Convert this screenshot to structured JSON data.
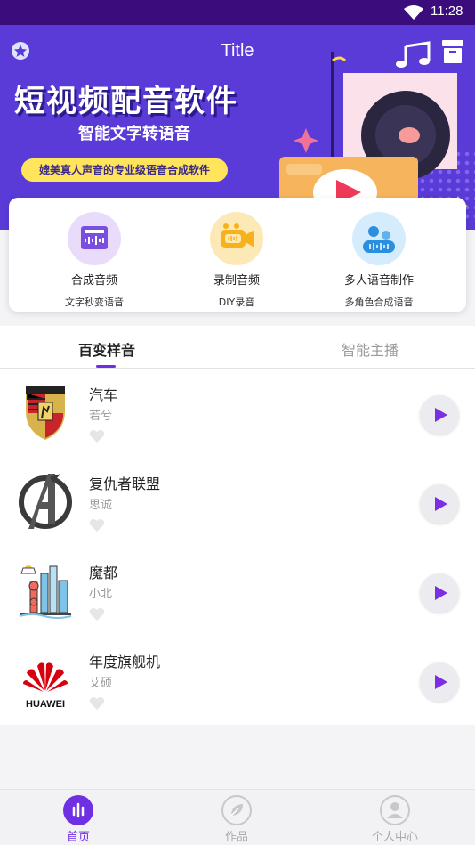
{
  "status_bar": {
    "time": "11:28"
  },
  "header": {
    "title": "Title"
  },
  "banner": {
    "headline": "短视频配音软件",
    "subtitle": "智能文字转语音",
    "tagline": "媲美真人声音的专业级语音合成软件"
  },
  "features": [
    {
      "title": "合成音频",
      "desc": "文字秒变语音",
      "icon": "audio-synth-icon",
      "color": "#e9dcfa"
    },
    {
      "title": "录制音频",
      "desc": "DIY录音",
      "icon": "record-video-icon",
      "color": "#fde9b5"
    },
    {
      "title": "多人语音制作",
      "desc": "多角色合成语音",
      "icon": "multi-voice-icon",
      "color": "#d4ecfb"
    }
  ],
  "tabs": [
    {
      "label": "百变样音",
      "active": true
    },
    {
      "label": "智能主播",
      "active": false
    }
  ],
  "list": [
    {
      "name": "汽车",
      "voice": "若兮",
      "logo": "porsche-logo"
    },
    {
      "name": "复仇者联盟",
      "voice": "思诚",
      "logo": "avengers-logo"
    },
    {
      "name": "魔都",
      "voice": "小北",
      "logo": "shanghai-skyline-logo"
    },
    {
      "name": "年度旗舰机",
      "voice": "艾硕",
      "logo": "huawei-logo",
      "logo_text": "HUAWEI"
    }
  ],
  "bottom_nav": [
    {
      "label": "首页",
      "active": true,
      "icon": "home-bars-icon"
    },
    {
      "label": "作品",
      "active": false,
      "icon": "leaf-icon"
    },
    {
      "label": "个人中心",
      "active": false,
      "icon": "person-icon"
    }
  ],
  "colors": {
    "accent": "#6f2fe3",
    "banner": "#5a3bd7",
    "status_bar": "#3b0d7c"
  }
}
